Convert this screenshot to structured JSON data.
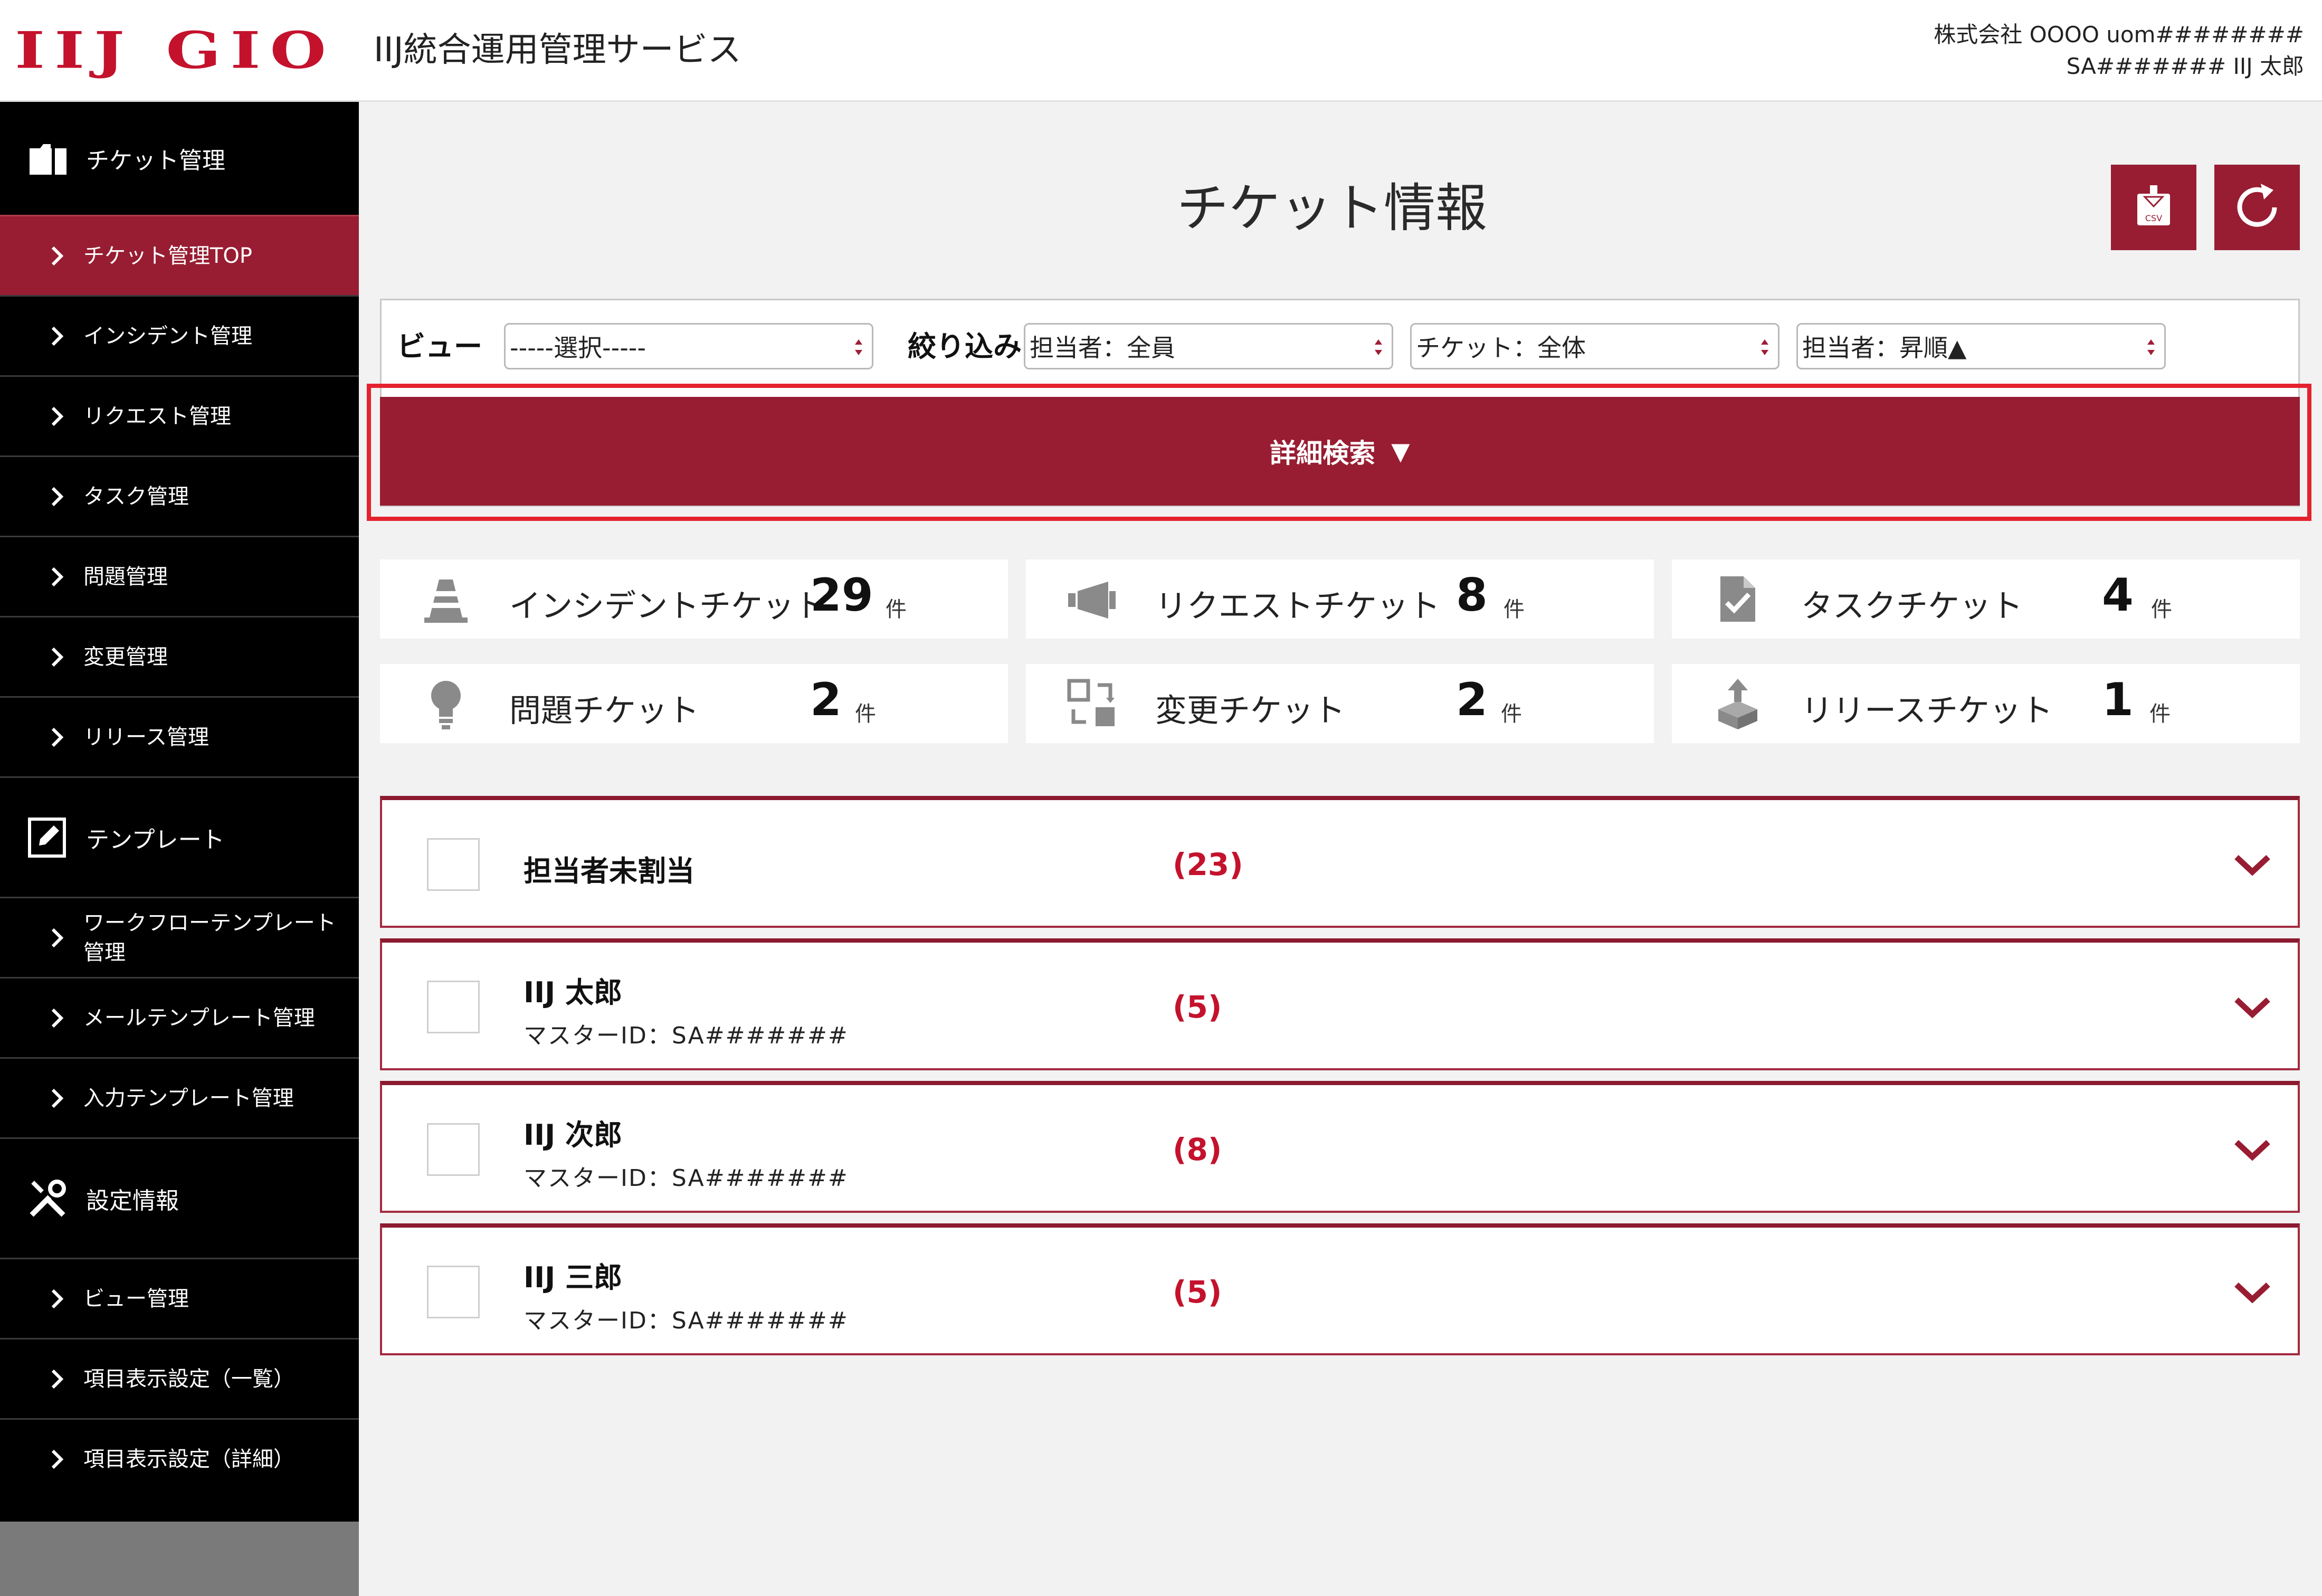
{
  "header": {
    "logo": "IIJ GIO",
    "service_name": "IIJ統合運用管理サービス",
    "user_line1": "株式会社 OOOO uom########",
    "user_line2": "SA####### IIJ 太郎"
  },
  "sidebar": {
    "sections": [
      {
        "label": "チケット管理",
        "icon": "ticket-icon"
      },
      {
        "label": "テンプレート",
        "icon": "edit-icon"
      },
      {
        "label": "設定情報",
        "icon": "tools-icon"
      }
    ],
    "items": [
      {
        "label": "チケット管理TOP",
        "active": true
      },
      {
        "label": "インシデント管理"
      },
      {
        "label": "リクエスト管理"
      },
      {
        "label": "タスク管理"
      },
      {
        "label": "問題管理"
      },
      {
        "label": "変更管理"
      },
      {
        "label": "リリース管理"
      },
      {
        "label": "ワークフローテンプレート管理"
      },
      {
        "label": "メールテンプレート管理"
      },
      {
        "label": "入力テンプレート管理"
      },
      {
        "label": "ビュー管理"
      },
      {
        "label": "項目表示設定（一覧）"
      },
      {
        "label": "項目表示設定（詳細）"
      }
    ]
  },
  "main": {
    "title": "チケット情報",
    "csv_button_label": "CSV",
    "filters": {
      "view_label": "ビュー",
      "view_value": "-----選択-----",
      "narrow_label": "絞り込み",
      "assignee_value": "担当者：全員",
      "ticket_value": "チケット：全体",
      "sort_value": "担当者：昇順▲"
    },
    "detail_search_label": "詳細検索",
    "detail_search_arrow": "▼",
    "unit": "件",
    "summary": [
      {
        "label": "インシデントチケット",
        "count": "29",
        "icon": "cone-icon"
      },
      {
        "label": "リクエストチケット",
        "count": "8",
        "icon": "megaphone-icon"
      },
      {
        "label": "タスクチケット",
        "count": "4",
        "icon": "task-doc-icon"
      },
      {
        "label": "問題チケット",
        "count": "2",
        "icon": "lightbulb-icon"
      },
      {
        "label": "変更チケット",
        "count": "2",
        "icon": "swap-icon"
      },
      {
        "label": "リリースチケット",
        "count": "1",
        "icon": "box-icon"
      }
    ],
    "groups": [
      {
        "name": "担当者未割当",
        "sub": "",
        "count": "(23)"
      },
      {
        "name": "IIJ 太郎",
        "sub": "マスターID：SA#######",
        "count": "(5)"
      },
      {
        "name": "IIJ 次郎",
        "sub": "マスターID：SA#######",
        "count": "(8)"
      },
      {
        "name": "IIJ 三郎",
        "sub": "マスターID：SA#######",
        "count": "(5)"
      }
    ]
  },
  "colors": {
    "brand": "#c4122d",
    "accent_dark_red": "#981d32",
    "highlight_outline": "#e4222e",
    "sidebar_bg": "#000000"
  }
}
